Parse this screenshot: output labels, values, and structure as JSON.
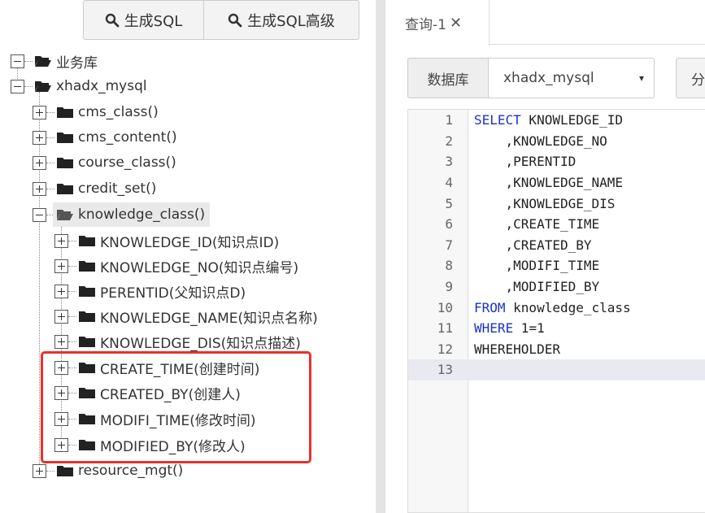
{
  "toolbar": {
    "gen_sql_label": "生成SQL",
    "gen_sql_adv_label": "生成SQL高级"
  },
  "tree": {
    "root1": "业务库",
    "root2": "xhadx_mysql",
    "tables": [
      "cms_class()",
      "cms_content()",
      "course_class()",
      "credit_set()",
      "knowledge_class()"
    ],
    "columns": [
      "KNOWLEDGE_ID(知识点ID)",
      "KNOWLEDGE_NO(知识点编号)",
      "PERENTID(父知识点D)",
      "KNOWLEDGE_NAME(知识点名称)",
      "KNOWLEDGE_DIS(知识点描述)",
      "CREATE_TIME(创建时间)",
      "CREATED_BY(创建人)",
      "MODIFI_TIME(修改时间)",
      "MODIFIED_BY(修改人)"
    ],
    "last_table": "resource_mgt()"
  },
  "tabs": {
    "query_tab": "查询-1",
    "close": "✕"
  },
  "db": {
    "label": "数据库",
    "selected": "xhadx_mysql",
    "caret": "▾",
    "side_button": "分"
  },
  "editor": {
    "lines": [
      {
        "n": "1",
        "kw": "SELECT",
        "rest": " KNOWLEDGE_ID"
      },
      {
        "n": "2",
        "kw": "",
        "rest": "    ,KNOWLEDGE_NO"
      },
      {
        "n": "3",
        "kw": "",
        "rest": "    ,PERENTID"
      },
      {
        "n": "4",
        "kw": "",
        "rest": "    ,KNOWLEDGE_NAME"
      },
      {
        "n": "5",
        "kw": "",
        "rest": "    ,KNOWLEDGE_DIS"
      },
      {
        "n": "6",
        "kw": "",
        "rest": "    ,CREATE_TIME"
      },
      {
        "n": "7",
        "kw": "",
        "rest": "    ,CREATED_BY"
      },
      {
        "n": "8",
        "kw": "",
        "rest": "    ,MODIFI_TIME"
      },
      {
        "n": "9",
        "kw": "",
        "rest": "    ,MODIFIED_BY"
      },
      {
        "n": "10",
        "kw": "FROM",
        "rest": " knowledge_class"
      },
      {
        "n": "11",
        "kw": "WHERE",
        "rest": " 1=1"
      },
      {
        "n": "12",
        "kw": "",
        "rest": "WHEREHOLDER"
      },
      {
        "n": "13",
        "kw": "",
        "rest": ""
      }
    ]
  }
}
